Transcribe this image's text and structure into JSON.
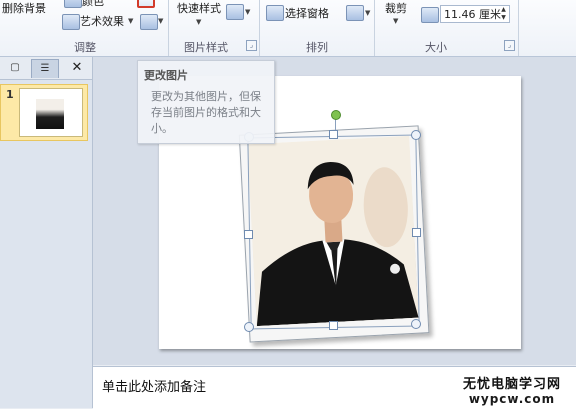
{
  "ribbon": {
    "adjust": {
      "remove_background": "删除背景",
      "color": "颜色",
      "artistic_effects": "艺术效果",
      "group_label": "调整"
    },
    "picture_styles": {
      "quick_styles": "快速样式",
      "group_label": "图片样式"
    },
    "arrange": {
      "selection_pane": "选择窗格",
      "group_label": "排列"
    },
    "size": {
      "crop": "裁剪",
      "width_value": "11.46 厘米",
      "group_label": "大小"
    },
    "accent_color": "#d23a2a"
  },
  "slide_pane": {
    "tab_slides_icon": "slides-tab-icon",
    "tab_outline_icon": "outline-tab-icon",
    "close_icon": "close-icon",
    "slide_number": "1"
  },
  "tooltip": {
    "title": "更改图片",
    "body": "更改为其他图片，但保存当前图片的格式和大小。"
  },
  "notes": {
    "placeholder": "单击此处添加备注"
  },
  "watermark": {
    "line1": "无忧电脑学习网",
    "line2": "wypcw.com"
  }
}
